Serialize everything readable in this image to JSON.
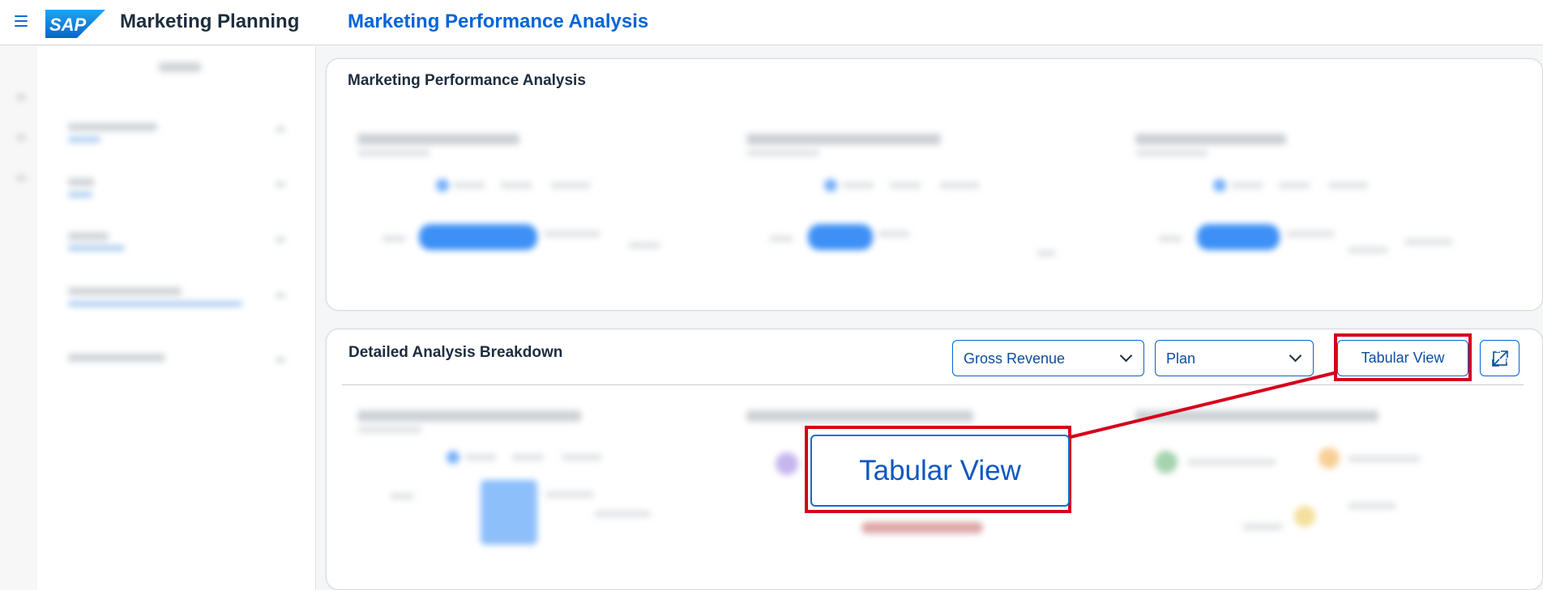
{
  "shell": {
    "logo_text": "SAP",
    "app_title": "Marketing Planning",
    "page_title": "Marketing Performance Analysis"
  },
  "colors": {
    "brand_blue": "#0064d9",
    "highlight_red": "#d6001c",
    "bar_blue": "#1b7cf5"
  },
  "icons": {
    "menu": "menu-icon",
    "chevron": "chevron-down-icon",
    "expand": "expand-icon"
  },
  "overview_card": {
    "title": "Marketing Performance Analysis"
  },
  "breakdown_card": {
    "title": "Detailed Analysis Breakdown",
    "measure_select": "Gross Revenue",
    "version_select": "Plan",
    "tabular_view_label": "Tabular View"
  },
  "callout": {
    "zoomed_label": "Tabular View"
  }
}
